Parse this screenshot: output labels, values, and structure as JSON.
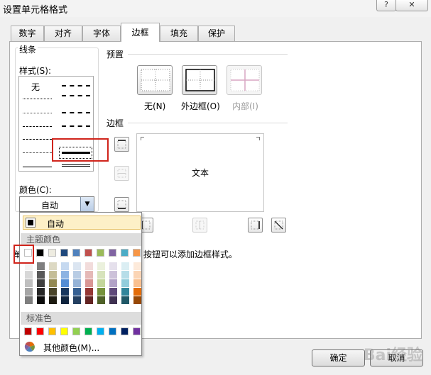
{
  "window": {
    "title": "设置单元格格式",
    "help_glyph": "?",
    "close_glyph": "✕"
  },
  "tabs": [
    "数字",
    "对齐",
    "字体",
    "边框",
    "填充",
    "保护"
  ],
  "line": {
    "group_title": "线条",
    "style_label": "样式(S):",
    "none_label": "无",
    "color_label": "颜色(C):",
    "color_value": "自动"
  },
  "presets": {
    "group_title": "预置",
    "items": [
      {
        "label": "无(N)",
        "icon": "no-border-icon"
      },
      {
        "label": "外边框(O)",
        "icon": "outline-border-icon"
      },
      {
        "label": "内部(I)",
        "icon": "inside-border-icon"
      }
    ]
  },
  "border": {
    "group_title": "边框",
    "preview_text": "文本",
    "hint_partial": "按钮可以添加边框样式。",
    "hint_leading": "单"
  },
  "color_dropdown": {
    "auto_label": "自动",
    "theme_header": "主题颜色",
    "standard_header": "标准色",
    "more_colors": "其他颜色(M)...",
    "theme_top": [
      "#ffffff",
      "#000000",
      "#eeece1",
      "#1f497d",
      "#4f81bd",
      "#c0504d",
      "#9bbb59",
      "#8064a2",
      "#4bacc6",
      "#f79646"
    ],
    "theme_shades": [
      [
        "#f2f2f2",
        "#d8d8d8",
        "#bfbfbf",
        "#a5a5a5",
        "#7f7f7f"
      ],
      [
        "#7f7f7f",
        "#595959",
        "#3f3f3f",
        "#262626",
        "#0c0c0c"
      ],
      [
        "#ddd9c3",
        "#c4bd97",
        "#938953",
        "#494429",
        "#1d1b10"
      ],
      [
        "#c6d9f0",
        "#8db3e2",
        "#548dd4",
        "#17365d",
        "#0f243e"
      ],
      [
        "#dbe5f1",
        "#b8cce4",
        "#95b3d7",
        "#366092",
        "#244061"
      ],
      [
        "#f2dcdb",
        "#e5b9b7",
        "#d99694",
        "#953734",
        "#632423"
      ],
      [
        "#ebf1dd",
        "#d7e3bc",
        "#c3d69b",
        "#76923c",
        "#4f6128"
      ],
      [
        "#e5e0ec",
        "#ccc1d9",
        "#b2a2c7",
        "#5f497a",
        "#3f3151"
      ],
      [
        "#dbeef3",
        "#b7dde8",
        "#92cddc",
        "#31859b",
        "#205867"
      ],
      [
        "#fdeada",
        "#fbd5b5",
        "#fac08f",
        "#e36c09",
        "#974806"
      ]
    ],
    "standard": [
      "#c00000",
      "#ff0000",
      "#ffc000",
      "#ffff00",
      "#92d050",
      "#00b050",
      "#00b0f0",
      "#0070c0",
      "#002060",
      "#7030a0"
    ]
  },
  "buttons": {
    "ok": "确定",
    "cancel": "取消"
  },
  "watermark": "Bai经验"
}
